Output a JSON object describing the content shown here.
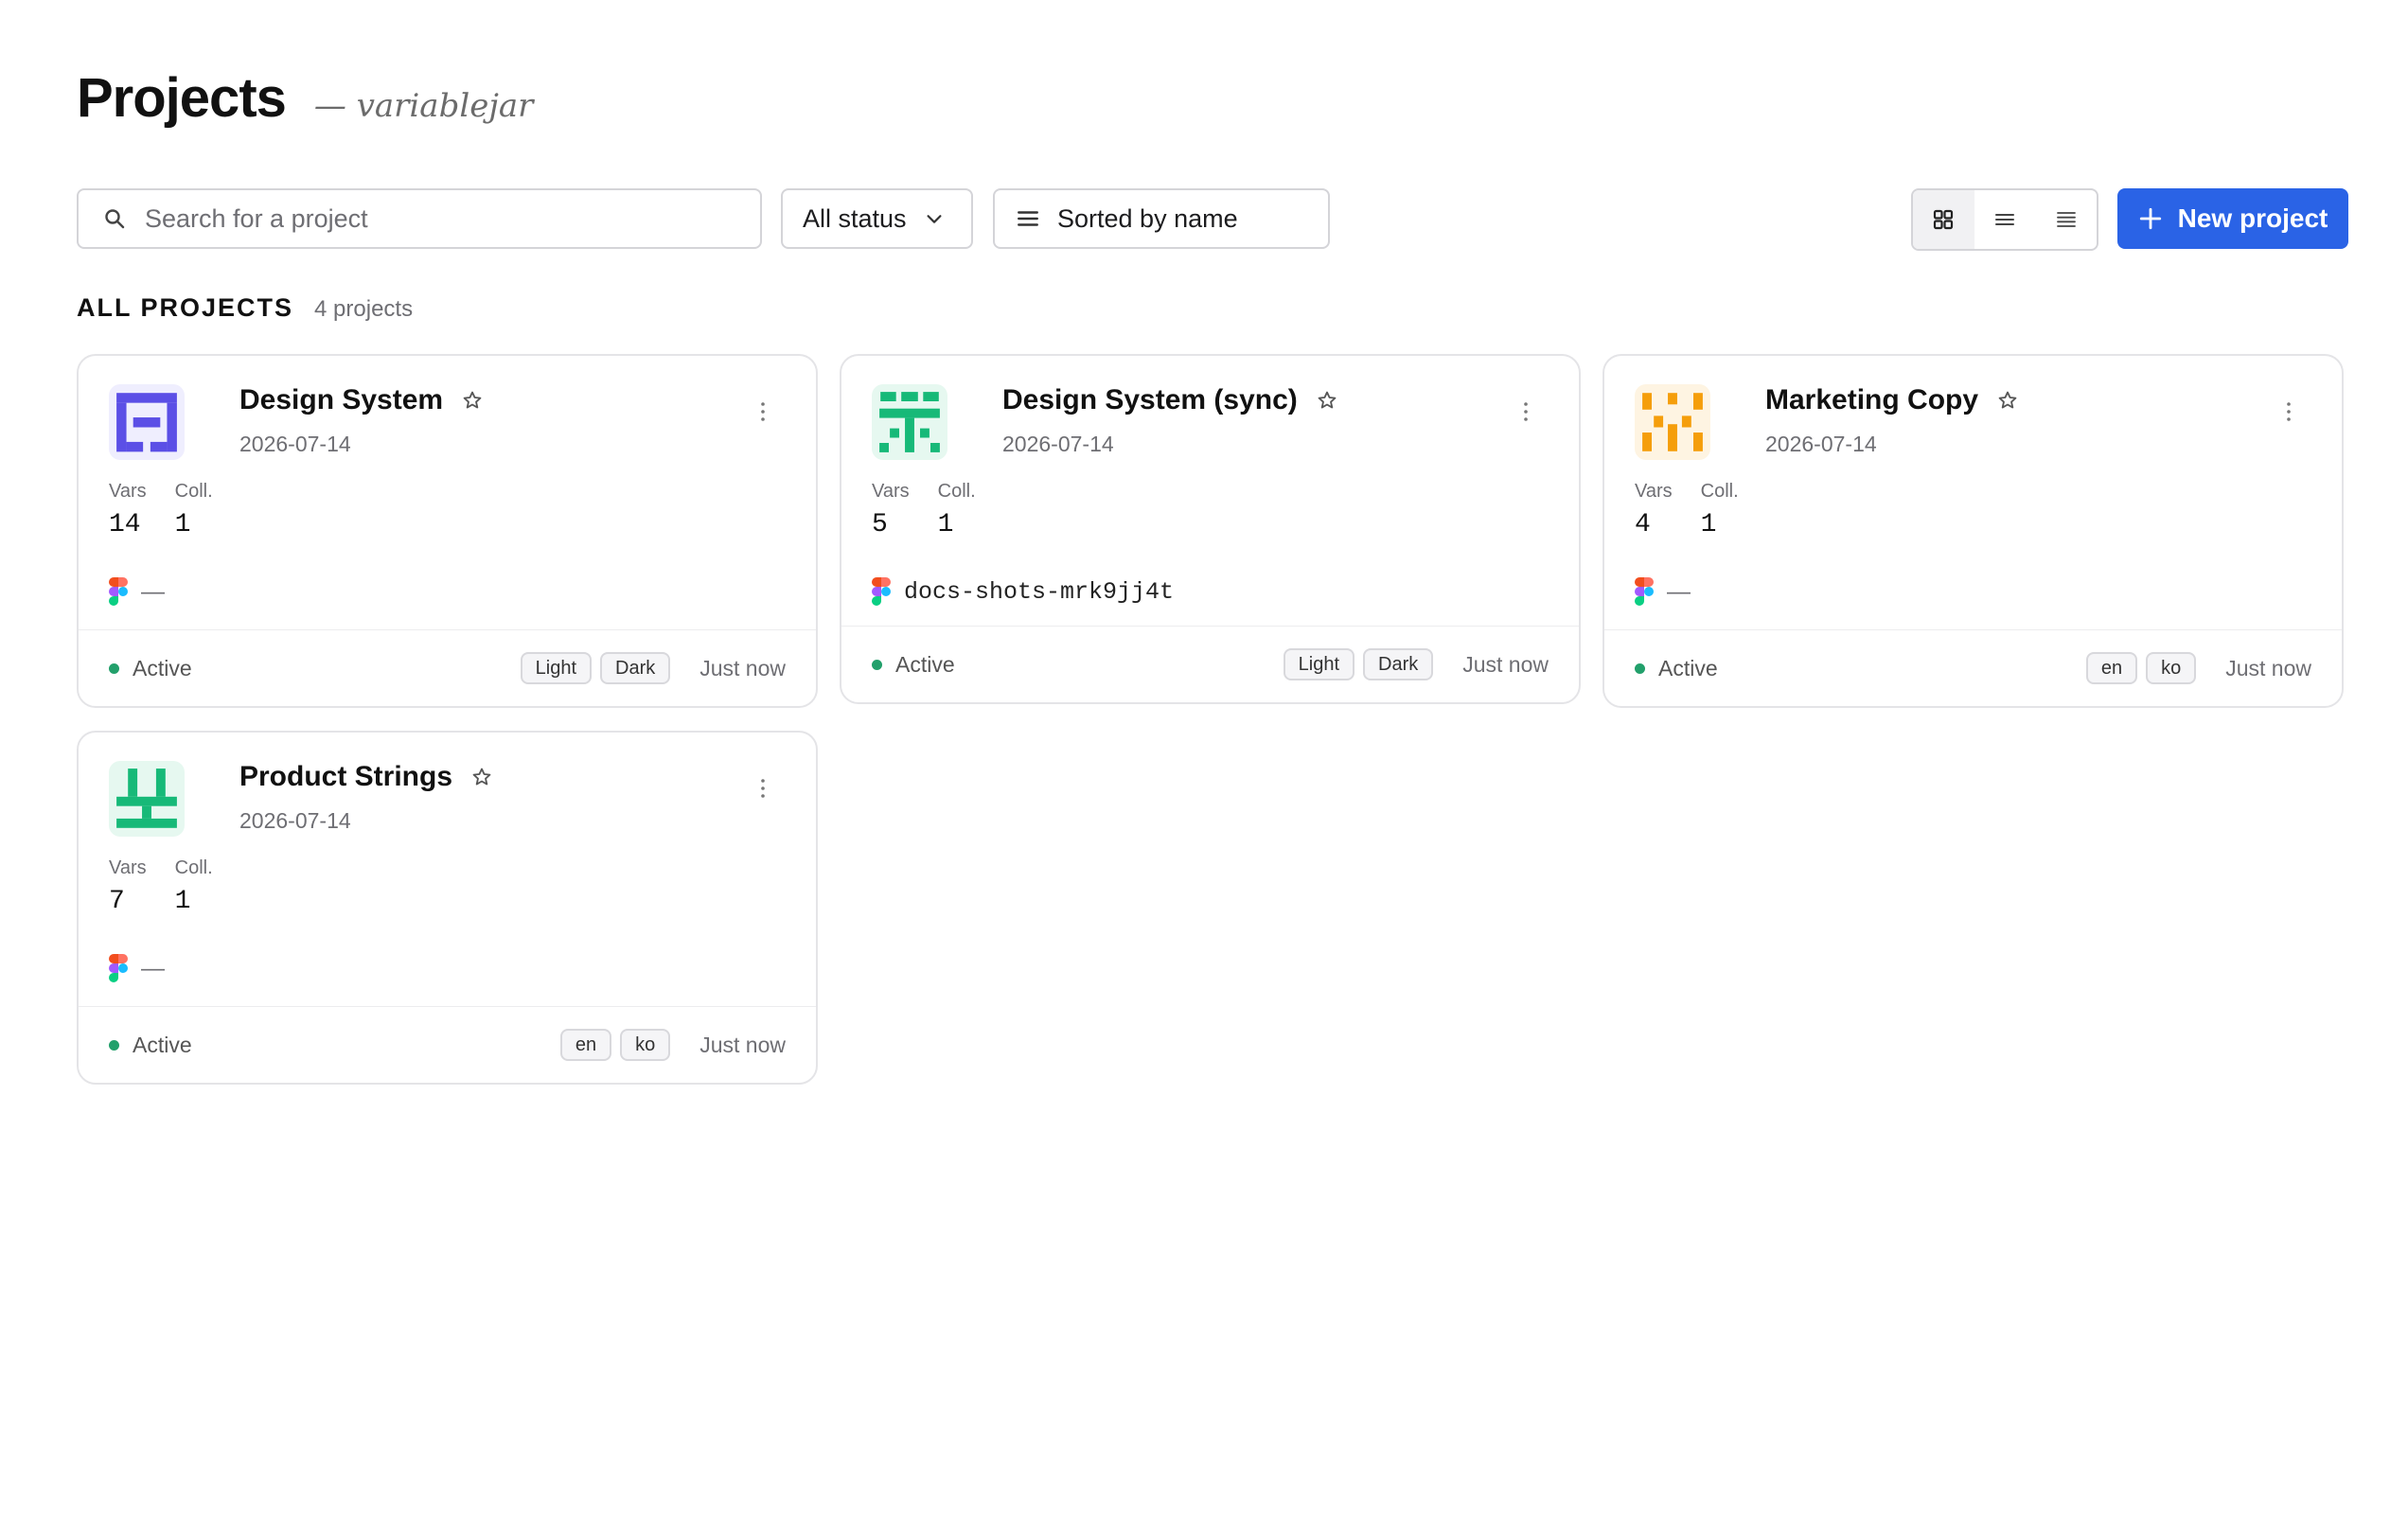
{
  "header": {
    "title": "Projects",
    "subtitle": "— variablejar"
  },
  "toolbar": {
    "search_placeholder": "Search for a project",
    "status_filter": "All status",
    "sort_label": "Sorted by name",
    "new_project_label": "New project",
    "active_view": "grid"
  },
  "section": {
    "title": "ALL PROJECTS",
    "count": "4 projects"
  },
  "stat_labels": {
    "vars": "Vars",
    "coll": "Coll."
  },
  "projects": [
    {
      "name": "Design System",
      "date": "2026-07-14",
      "vars": "14",
      "coll": "1",
      "figma": "—",
      "status": "Active",
      "tags": [
        "Light",
        "Dark"
      ],
      "updated": "Just now",
      "logo_color": "#5b4fe6",
      "logo_bg": "#efeefe"
    },
    {
      "name": "Design System (sync)",
      "date": "2026-07-14",
      "vars": "5",
      "coll": "1",
      "figma": "docs-shots-mrk9jj4t",
      "status": "Active",
      "tags": [
        "Light",
        "Dark"
      ],
      "updated": "Just now",
      "logo_color": "#17b978",
      "logo_bg": "#e6f8f0"
    },
    {
      "name": "Marketing Copy",
      "date": "2026-07-14",
      "vars": "4",
      "coll": "1",
      "figma": "—",
      "status": "Active",
      "tags": [
        "en",
        "ko"
      ],
      "updated": "Just now",
      "logo_color": "#f59e0b",
      "logo_bg": "#fef4e2"
    },
    {
      "name": "Product Strings",
      "date": "2026-07-14",
      "vars": "7",
      "coll": "1",
      "figma": "—",
      "status": "Active",
      "tags": [
        "en",
        "ko"
      ],
      "updated": "Just now",
      "logo_color": "#17b978",
      "logo_bg": "#e6f8f0"
    }
  ],
  "colors": {
    "accent": "#2a63e6",
    "status_active": "#22a06b"
  },
  "icons": {
    "search": "search-icon",
    "chevron": "chevron-down-icon",
    "sort": "sort-icon",
    "grid_view": "grid-view-icon",
    "list_view": "list-view-icon",
    "compact_view": "compact-list-icon",
    "plus": "plus-icon",
    "star": "star-icon",
    "more": "more-vertical-icon",
    "figma": "figma-icon"
  }
}
